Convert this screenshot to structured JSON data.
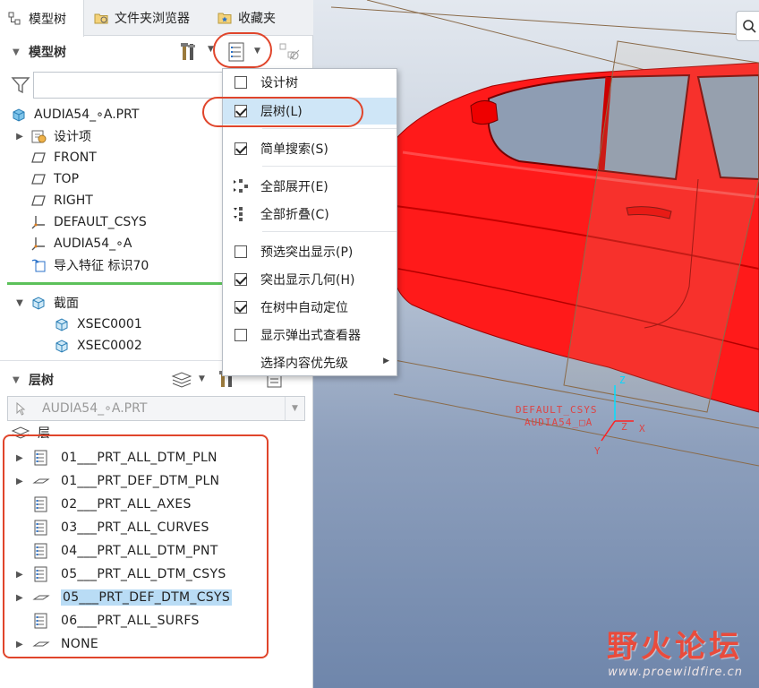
{
  "tabs": [
    {
      "label": "模型树",
      "icon": "model-tree-icon"
    },
    {
      "label": "文件夹浏览器",
      "icon": "folder-browser-icon"
    },
    {
      "label": "收藏夹",
      "icon": "favorites-icon"
    }
  ],
  "model_tree": {
    "title": "模型树",
    "filter_value": "",
    "root": "AUDIA54_∘A.PRT",
    "items": [
      {
        "label": "设计项",
        "icon": "design-items-icon",
        "expandable": true
      },
      {
        "label": "FRONT",
        "icon": "datum-plane-icon",
        "expandable": false
      },
      {
        "label": "TOP",
        "icon": "datum-plane-icon",
        "expandable": false
      },
      {
        "label": "RIGHT",
        "icon": "datum-plane-icon",
        "expandable": false
      },
      {
        "label": "DEFAULT_CSYS",
        "icon": "csys-icon",
        "expandable": false
      },
      {
        "label": "AUDIA54_∘A",
        "icon": "csys-icon",
        "expandable": false
      },
      {
        "label": "导入特征 标识70",
        "icon": "import-feature-icon",
        "expandable": false
      }
    ]
  },
  "sections": {
    "title": "截面",
    "items": [
      "XSEC0001",
      "XSEC0002"
    ]
  },
  "layer_tree": {
    "title": "层树",
    "model_select": "AUDIA54_∘A.PRT",
    "root_label": "层",
    "layers": [
      {
        "label": "01___PRT_ALL_DTM_PLN",
        "expandable": true,
        "icon": "layer-rule-icon",
        "selected": false
      },
      {
        "label": "01___PRT_DEF_DTM_PLN",
        "expandable": true,
        "icon": "layer-plain-icon",
        "selected": false
      },
      {
        "label": "02___PRT_ALL_AXES",
        "expandable": false,
        "icon": "layer-rule-icon",
        "selected": false
      },
      {
        "label": "03___PRT_ALL_CURVES",
        "expandable": false,
        "icon": "layer-rule-icon",
        "selected": false
      },
      {
        "label": "04___PRT_ALL_DTM_PNT",
        "expandable": false,
        "icon": "layer-rule-icon",
        "selected": false
      },
      {
        "label": "05___PRT_ALL_DTM_CSYS",
        "expandable": true,
        "icon": "layer-rule-icon",
        "selected": false
      },
      {
        "label": "05___PRT_DEF_DTM_CSYS",
        "expandable": true,
        "icon": "layer-plain-icon",
        "selected": true
      },
      {
        "label": "06___PRT_ALL_SURFS",
        "expandable": false,
        "icon": "layer-rule-icon",
        "selected": false
      },
      {
        "label": "NONE",
        "expandable": true,
        "icon": "layer-plain-icon",
        "selected": false
      }
    ]
  },
  "menu": {
    "items": [
      {
        "label": "设计树",
        "kind": "checkbox",
        "checked": false
      },
      {
        "label": "层树(L)",
        "kind": "checkbox",
        "checked": true,
        "highlighted": true
      },
      {
        "label": "简单搜索(S)",
        "kind": "checkbox",
        "checked": true
      },
      {
        "label": "全部展开(E)",
        "kind": "icon",
        "icon": "expand-all-icon"
      },
      {
        "label": "全部折叠(C)",
        "kind": "icon",
        "icon": "collapse-all-icon"
      },
      {
        "label": "预选突出显示(P)",
        "kind": "checkbox",
        "checked": false
      },
      {
        "label": "突出显示几何(H)",
        "kind": "checkbox",
        "checked": true
      },
      {
        "label": "在树中自动定位",
        "kind": "checkbox",
        "checked": true
      },
      {
        "label": "显示弹出式查看器",
        "kind": "checkbox",
        "checked": false
      },
      {
        "label": "选择内容优先级",
        "kind": "submenu"
      }
    ]
  },
  "viewport": {
    "csys_label_1": "DEFAULT_CSYS",
    "csys_label_2": "AUDIA54_□A",
    "axis_x": "X",
    "axis_y": "Y",
    "axis_z": "Z",
    "axis_z2": "Z",
    "model_color": "#ff1a1a"
  },
  "watermark": {
    "title": "野火论坛",
    "url": "www.proewildfire.cn"
  },
  "colors": {
    "annotation_red": "#e0452b",
    "selection_blue": "#b9dcf5",
    "menu_highlight": "#cfe6f7",
    "green_divider": "#5cc15a"
  }
}
